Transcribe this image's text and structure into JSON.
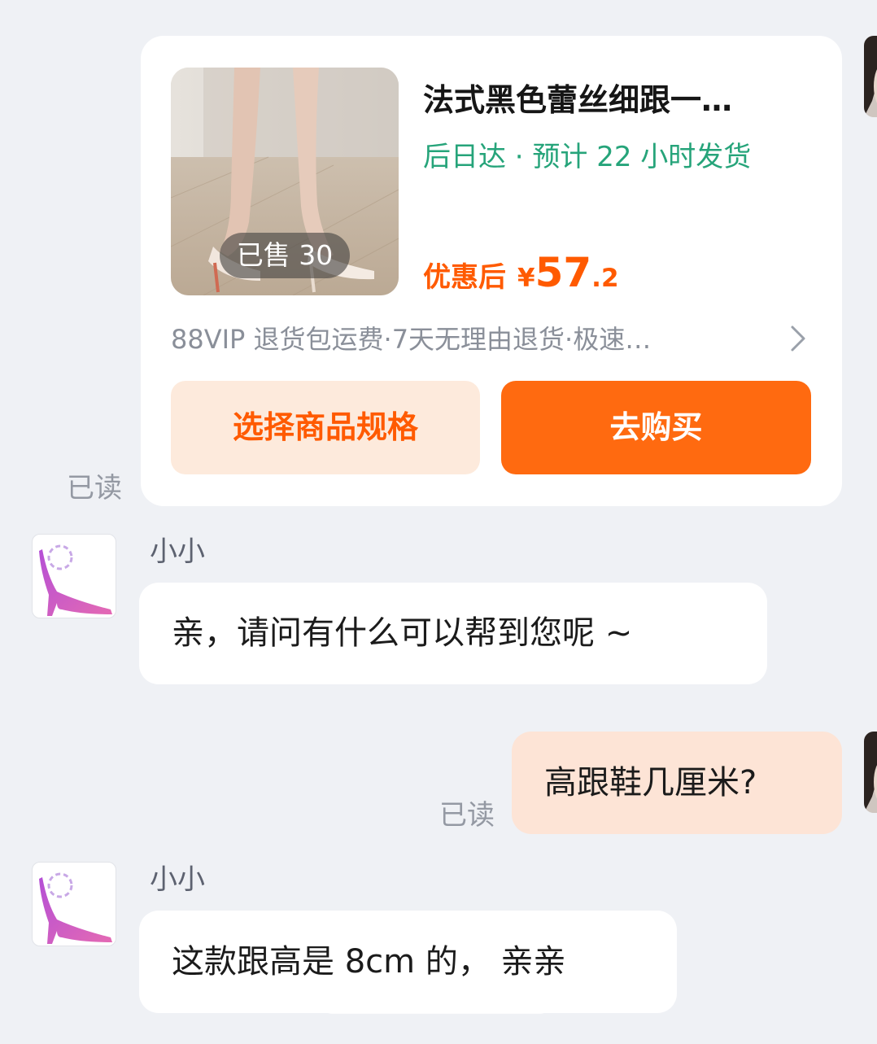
{
  "colors": {
    "background": "#eff1f5",
    "accent_orange": "#ff5a00",
    "button_orange": "#ff6a10",
    "button_light": "#fdeadc",
    "delivery_green": "#26a47a",
    "outgoing_bubble": "#fde4d6"
  },
  "product_card": {
    "image_icon": "product-photo-high-heel-mules",
    "sold_badge": "已售 30",
    "title": "法式黑色蕾丝细跟一…",
    "delivery": "后日达 · 预计 22 小时发货",
    "price_label": "优惠后",
    "price_currency": "¥",
    "price_integer": "57",
    "price_decimal": ".2",
    "services": "88VIP 退货包运费·7天无理由退货·极速…",
    "services_chevron_icon": "chevron-right-icon",
    "spec_button": "选择商品规格",
    "buy_button": "去购买",
    "read_status": "已读"
  },
  "messages": [
    {
      "direction": "incoming",
      "sender": "小小",
      "avatar_icon": "high-heel-logo",
      "text": "亲，请问有什么可以帮到您呢 ~"
    },
    {
      "direction": "outgoing",
      "text": "高跟鞋几厘米?",
      "read_status": "已读"
    },
    {
      "direction": "incoming",
      "sender": "小小",
      "avatar_icon": "high-heel-logo",
      "text": "这款跟高是 8cm 的， 亲亲"
    }
  ]
}
